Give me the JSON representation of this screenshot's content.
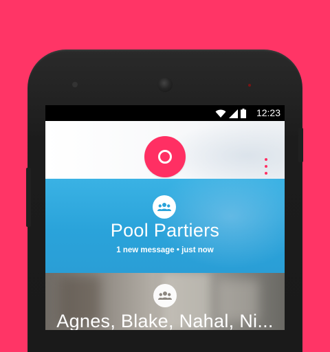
{
  "status_bar": {
    "time": "12:23",
    "icons": [
      "wifi-icon",
      "signal-icon",
      "battery-icon"
    ]
  },
  "app_bar": {
    "camera_button_icon": "camera-shutter-icon",
    "menu_icon": "more-vert-icon",
    "accent_color": "#ff2f63"
  },
  "conversations": [
    {
      "title": "Pool Partiers",
      "subtitle": "1 new message • just now",
      "icon": "group-icon",
      "color": "#2aa3da"
    },
    {
      "title": "Agnes, Blake, Nahal, Ni...",
      "icon": "group-icon"
    }
  ],
  "colors": {
    "background": "#ff3566",
    "accent": "#ff2f63",
    "card_blue": "#2aa3da"
  }
}
